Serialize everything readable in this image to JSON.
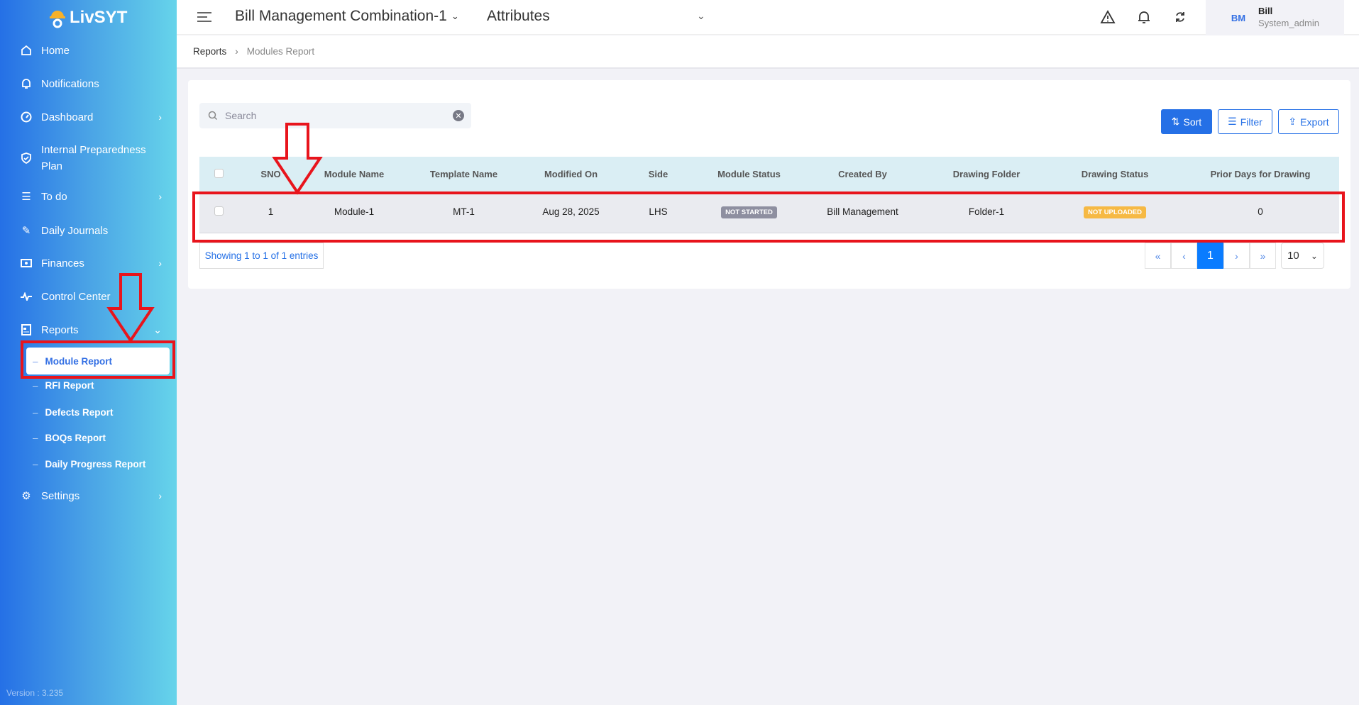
{
  "app": {
    "logo_text": "LivSYT",
    "version": "Version : 3.235"
  },
  "sidebar": {
    "items": [
      {
        "label": "Home",
        "icon": "home-icon"
      },
      {
        "label": "Notifications",
        "icon": "bell-icon"
      },
      {
        "label": "Dashboard",
        "icon": "gauge-icon"
      },
      {
        "label": "Internal Preparedness",
        "label2": "Plan",
        "icon": "shield-check-icon"
      },
      {
        "label": "To do",
        "icon": "list-icon"
      },
      {
        "label": "Daily Journals",
        "icon": "pencil-icon"
      },
      {
        "label": "Finances",
        "icon": "money-icon"
      },
      {
        "label": "Control Center",
        "icon": "pulse-icon"
      },
      {
        "label": "Reports",
        "icon": "report-icon"
      },
      {
        "label": "Settings",
        "icon": "gear-icon"
      }
    ],
    "reports_sub": [
      "Module Report",
      "RFI Report",
      "Defects Report",
      "BOQs Report",
      "Daily Progress Report"
    ]
  },
  "header": {
    "project": "Bill Management Combination-1",
    "attributes": "Attributes",
    "user_initials": "BM",
    "user_name": "Bill",
    "user_role": "System_admin"
  },
  "breadcrumb": {
    "parent": "Reports",
    "sep": "›",
    "current": "Modules Report"
  },
  "toolbar": {
    "search_placeholder": "Search",
    "sort": "Sort",
    "filter": "Filter",
    "export": "Export"
  },
  "table": {
    "columns": [
      "SNO",
      "Module Name",
      "Template Name",
      "Modified On",
      "Side",
      "Module Status",
      "Created By",
      "Drawing Folder",
      "Drawing Status",
      "Prior Days for Drawing"
    ],
    "rows": [
      {
        "sno": "1",
        "module": "Module-1",
        "template": "MT-1",
        "modified": "Aug 28, 2025",
        "side": "LHS",
        "module_status": "NOT STARTED",
        "created_by": "Bill Management",
        "folder": "Folder-1",
        "drawing_status": "NOT UPLOADED",
        "prior_days": "0"
      }
    ]
  },
  "footer": {
    "showing": "Showing 1 to 1 of 1 entries",
    "first": "«",
    "prev": "‹",
    "page": "1",
    "next": "›",
    "last": "»",
    "page_size": "10"
  },
  "colors": {
    "accent": "#2570e6",
    "not_started": "#8e8fa0",
    "not_uploaded": "#f6b944",
    "annotation": "#e8141c"
  }
}
